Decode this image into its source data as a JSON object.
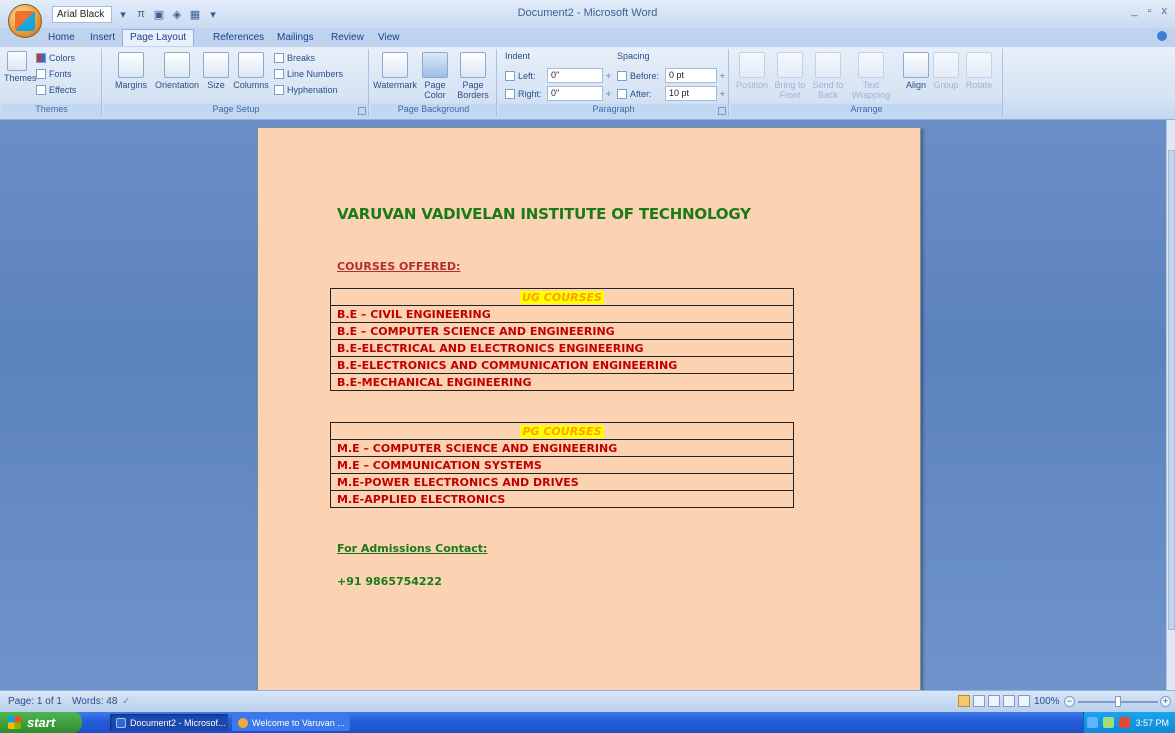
{
  "window": {
    "title": "Document2 - Microsoft Word",
    "controls": [
      "_",
      "▫",
      "x"
    ]
  },
  "quick_access": {
    "font_name": "Arial Black",
    "icons": [
      "pi-icon",
      "border-icon",
      "shading-icon",
      "table-icon"
    ]
  },
  "tabs": [
    "Home",
    "Insert",
    "Page Layout",
    "References",
    "Mailings",
    "Review",
    "View"
  ],
  "active_tab": "Page Layout",
  "ribbon": {
    "themes": {
      "label": "Themes",
      "big": "Themes",
      "colors": "Colors",
      "fonts": "Fonts",
      "effects": "Effects"
    },
    "page_setup": {
      "label": "Page Setup",
      "margins": "Margins",
      "orientation": "Orientation",
      "size": "Size",
      "columns": "Columns",
      "breaks": "Breaks",
      "line_numbers": "Line Numbers",
      "hyphenation": "Hyphenation"
    },
    "page_background": {
      "label": "Page Background",
      "watermark": "Watermark",
      "page_color": "Page Color",
      "page_borders": "Page Borders"
    },
    "paragraph": {
      "label": "Paragraph",
      "indent": "Indent",
      "spacing": "Spacing",
      "left_label": "Left:",
      "left_value": "0\"",
      "right_label": "Right:",
      "right_value": "0\"",
      "before_label": "Before:",
      "before_value": "0 pt",
      "after_label": "After:",
      "after_value": "10 pt"
    },
    "arrange": {
      "label": "Arrange",
      "position": "Position",
      "bring_to_front": "Bring to Front",
      "send_to_back": "Send to Back",
      "text_wrapping": "Text Wrapping",
      "align": "Align",
      "group": "Group",
      "rotate": "Rotate"
    }
  },
  "document": {
    "heading": "VARUVAN VADIVELAN INSTITUTE OF TECHNOLOGY",
    "courses_offered": "COURSES OFFERED:",
    "ug": {
      "header": "UG COURSES",
      "rows": [
        "B.E – CIVIL ENGINEERING",
        "B.E – COMPUTER SCIENCE AND ENGINEERING",
        "B.E-ELECTRICAL AND ELECTRONICS ENGINEERING",
        "B.E-ELECTRONICS AND COMMUNICATION ENGINEERING",
        "B.E-MECHANICAL ENGINEERING"
      ]
    },
    "pg": {
      "header": "PG COURSES",
      "rows": [
        "M.E – COMPUTER SCIENCE AND ENGINEERING",
        "M.E – COMMUNICATION SYSTEMS",
        "M.E-POWER ELECTRONICS AND DRIVES",
        "M.E-APPLIED ELECTRONICS"
      ]
    },
    "contact_label": "For Admissions Contact:",
    "contact_phone": "+91 9865754222"
  },
  "statusbar": {
    "page": "Page: 1 of 1",
    "words": "Words: 48",
    "zoom": "100%"
  },
  "taskbar": {
    "start": "start",
    "items": [
      "Document2 - Microsof...",
      "Welcome to Varuvan ..."
    ],
    "clock": "3:57 PM"
  },
  "colors": {
    "page_bg": "#fbd3b3",
    "heading": "#1a7a1a",
    "course_text": "#c00000",
    "highlight": "#ffff00"
  }
}
